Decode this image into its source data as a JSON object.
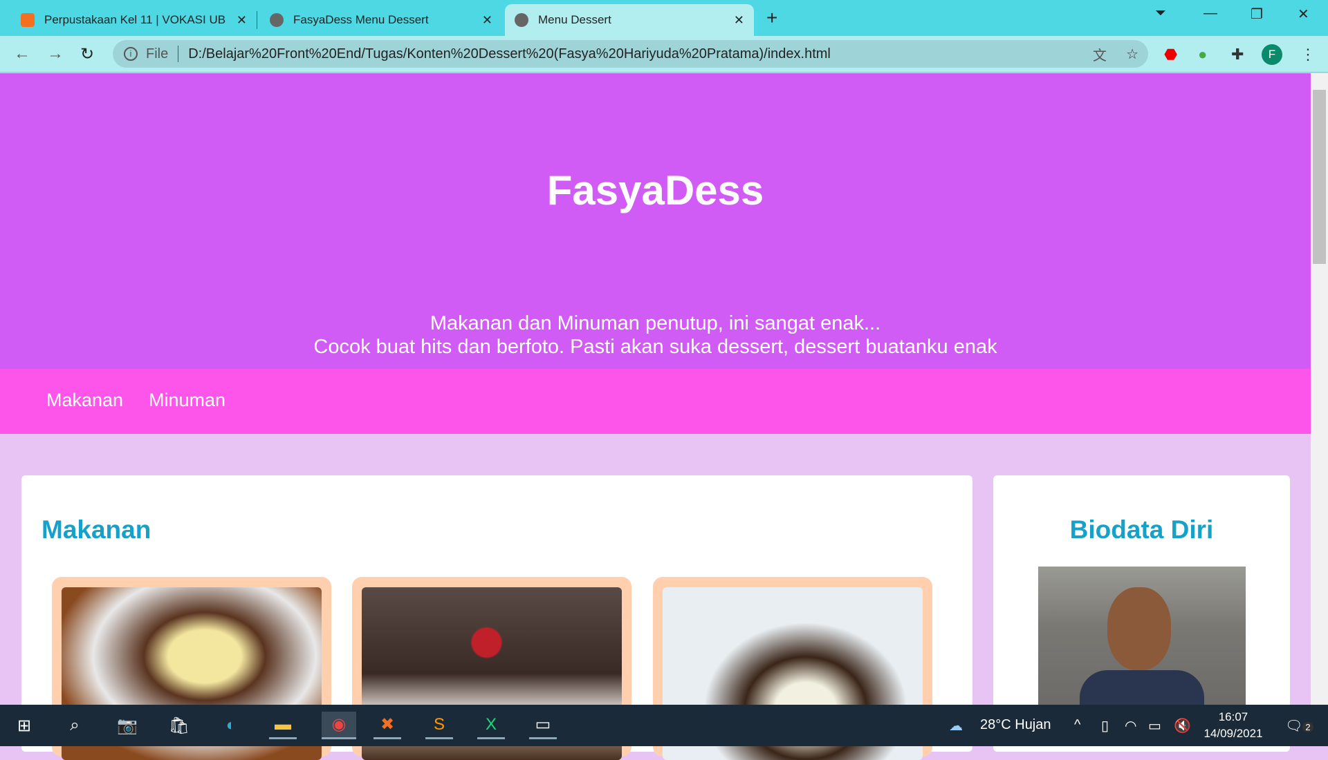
{
  "browser": {
    "tabs": [
      {
        "title": "Perpustakaan Kel 11 | VOKASI UB"
      },
      {
        "title": "FasyaDess Menu Dessert"
      },
      {
        "title": "Menu Dessert"
      }
    ],
    "address_prefix": "File",
    "url": "D:/Belajar%20Front%20End/Tugas/Konten%20Dessert%20(Fasya%20Hariyuda%20Pratama)/index.html",
    "profile_initial": "F"
  },
  "page": {
    "title": "FasyaDess",
    "subtitle_line1": "Makanan dan Minuman penutup, ini sangat enak...",
    "subtitle_line2": "Cocok buat hits dan berfoto. Pasti akan suka dessert, dessert buatanku enak",
    "nav": [
      "Makanan",
      "Minuman"
    ],
    "section_title": "Makanan",
    "sidebar_title": "Biodata Diri"
  },
  "taskbar": {
    "weather": "28°C  Hujan",
    "time": "16:07",
    "date": "14/09/2021",
    "notifications": "2"
  },
  "colors": {
    "header": "#d05bf5",
    "nav": "#fd55e9",
    "heading": "#17a0c8",
    "card": "#ffcfae"
  }
}
